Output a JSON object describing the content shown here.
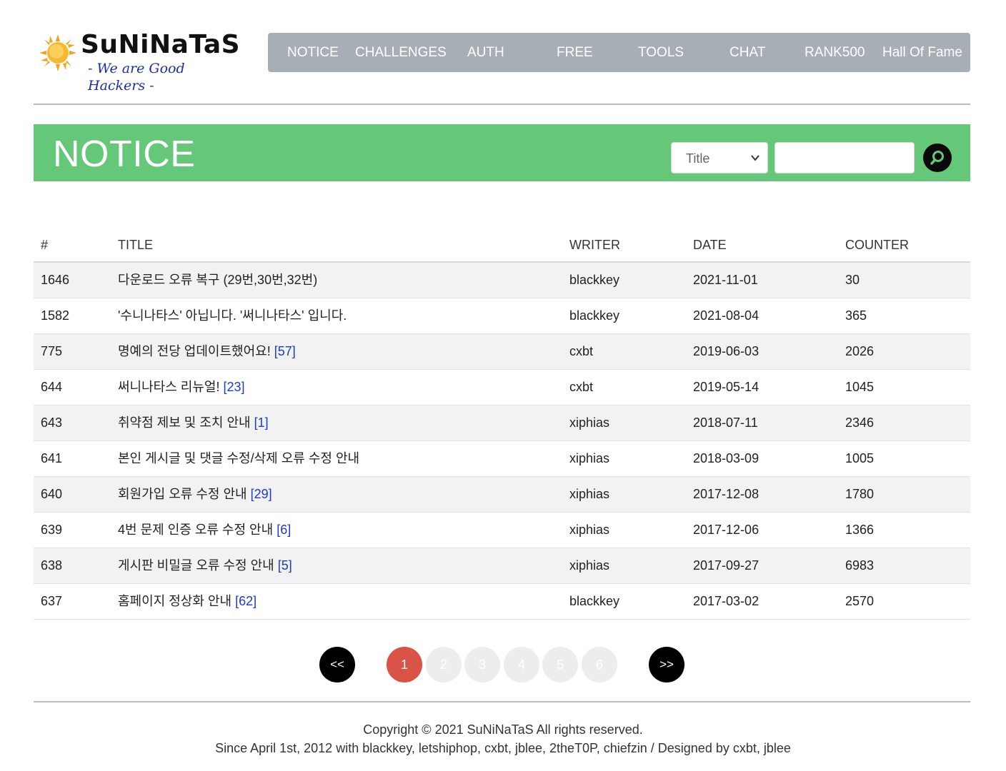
{
  "logo": {
    "brand": "SuNiNaTaS",
    "tagline": "- We are Good Hackers -"
  },
  "nav": {
    "items": [
      "NOTICE",
      "CHALLENGES",
      "AUTH",
      "FREE",
      "TOOLS",
      "CHAT",
      "RANK500",
      "Hall Of Fame"
    ]
  },
  "banner": {
    "title": "NOTICE",
    "search_field_selected": "Title",
    "search_value": ""
  },
  "table": {
    "headers": {
      "num": "#",
      "title": "TITLE",
      "writer": "WRITER",
      "date": "DATE",
      "counter": "COUNTER"
    },
    "rows": [
      {
        "num": "1646",
        "title": "다운로드 오류 복구 (29번,30번,32번)",
        "comments": "",
        "writer": "blackkey",
        "date": "2021-11-01",
        "counter": "30"
      },
      {
        "num": "1582",
        "title": "'수니나타스' 아닙니다. '써니나타스' 입니다.",
        "comments": "",
        "writer": "blackkey",
        "date": "2021-08-04",
        "counter": "365"
      },
      {
        "num": "775",
        "title": "명예의 전당 업데이트했어요!",
        "comments": "[57]",
        "writer": "cxbt",
        "date": "2019-06-03",
        "counter": "2026"
      },
      {
        "num": "644",
        "title": "써니나타스 리뉴얼!",
        "comments": "[23]",
        "writer": "cxbt",
        "date": "2019-05-14",
        "counter": "1045"
      },
      {
        "num": "643",
        "title": "취약점 제보 및 조치 안내",
        "comments": "[1]",
        "writer": "xiphias",
        "date": "2018-07-11",
        "counter": "2346"
      },
      {
        "num": "641",
        "title": "본인 게시글 및 댓글 수정/삭제 오류 수정 안내",
        "comments": "",
        "writer": "xiphias",
        "date": "2018-03-09",
        "counter": "1005"
      },
      {
        "num": "640",
        "title": "회원가입 오류 수정 안내",
        "comments": "[29]",
        "writer": "xiphias",
        "date": "2017-12-08",
        "counter": "1780"
      },
      {
        "num": "639",
        "title": "4번 문제 인증 오류 수정 안내",
        "comments": "[6]",
        "writer": "xiphias",
        "date": "2017-12-06",
        "counter": "1366"
      },
      {
        "num": "638",
        "title": "게시판 비밀글 오류 수정 안내",
        "comments": "[5]",
        "writer": "xiphias",
        "date": "2017-09-27",
        "counter": "6983"
      },
      {
        "num": "637",
        "title": "홈페이지 정상화 안내",
        "comments": "[62]",
        "writer": "blackkey",
        "date": "2017-03-02",
        "counter": "2570"
      }
    ]
  },
  "pagination": {
    "prev_label": "<<",
    "next_label": ">>",
    "pages": [
      "1",
      "2",
      "3",
      "4",
      "5",
      "6"
    ],
    "current": "1"
  },
  "footer": {
    "copyright": "Copyright © 2021 SuNiNaTaS All rights reserved.",
    "credits": "Since April 1st, 2012 with blackkey, letshiphop, cxbt, jblee, 2theT0P, chiefzin / Designed by cxbt, jblee"
  },
  "colors": {
    "nav_bg": "#a8aeb6",
    "banner_bg": "#65c878",
    "active_page": "#d95446",
    "comment_link": "#1a3ad6",
    "tagline": "#1a2ea8"
  }
}
